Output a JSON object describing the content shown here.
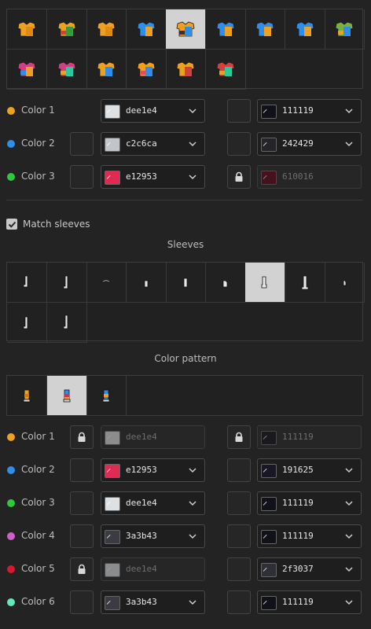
{
  "tops_grid": {
    "items": [
      {
        "icon": "top-icon-1",
        "selected": false
      },
      {
        "icon": "top-icon-2",
        "selected": false
      },
      {
        "icon": "top-icon-3",
        "selected": false
      },
      {
        "icon": "top-icon-4",
        "selected": false
      },
      {
        "icon": "top-icon-5",
        "selected": true
      },
      {
        "icon": "top-icon-6",
        "selected": false
      },
      {
        "icon": "top-icon-7",
        "selected": false
      },
      {
        "icon": "top-icon-8",
        "selected": false
      },
      {
        "icon": "top-icon-9",
        "selected": false
      },
      {
        "icon": "top-icon-10",
        "selected": false
      },
      {
        "icon": "top-icon-11",
        "selected": false
      },
      {
        "icon": "top-icon-12",
        "selected": false
      },
      {
        "icon": "top-icon-13",
        "selected": false
      },
      {
        "icon": "top-icon-14",
        "selected": false
      },
      {
        "icon": "top-icon-15",
        "selected": false
      }
    ]
  },
  "top_colors": [
    {
      "label": "Color 1",
      "dot": "#f0a020",
      "left_lock": false,
      "left_empty": false,
      "primary": {
        "hex": "dee1e4",
        "swatch": "#dee1e4",
        "disabled": false
      },
      "right_lock": false,
      "secondary": {
        "hex": "111119",
        "swatch": "#111119",
        "disabled": false
      }
    },
    {
      "label": "Color 2",
      "dot": "#2f8fe8",
      "left_lock": false,
      "left_empty": true,
      "primary": {
        "hex": "c2c6ca",
        "swatch": "#c2c6ca",
        "disabled": false
      },
      "right_lock": false,
      "secondary": {
        "hex": "242429",
        "swatch": "#242429",
        "disabled": false
      }
    },
    {
      "label": "Color 3",
      "dot": "#2ec840",
      "left_lock": false,
      "left_empty": true,
      "primary": {
        "hex": "e12953",
        "swatch": "#e12953",
        "disabled": false
      },
      "right_lock": true,
      "secondary": {
        "hex": "610016",
        "swatch": "#610016",
        "disabled": true
      }
    }
  ],
  "match_sleeves": {
    "label": "Match sleeves",
    "checked": true
  },
  "sleeves": {
    "title": "Sleeves",
    "items": [
      {
        "icon": "sleeve-icon-1",
        "selected": false
      },
      {
        "icon": "sleeve-icon-2",
        "selected": false
      },
      {
        "icon": "sleeve-icon-3",
        "selected": false
      },
      {
        "icon": "sleeve-icon-4",
        "selected": false
      },
      {
        "icon": "sleeve-icon-5",
        "selected": false
      },
      {
        "icon": "sleeve-icon-6",
        "selected": false
      },
      {
        "icon": "sleeve-icon-7",
        "selected": true
      },
      {
        "icon": "sleeve-icon-8",
        "selected": false
      },
      {
        "icon": "sleeve-icon-9",
        "selected": false
      },
      {
        "icon": "sleeve-icon-10",
        "selected": false
      },
      {
        "icon": "sleeve-icon-11",
        "selected": false
      }
    ]
  },
  "pattern": {
    "title": "Color pattern",
    "items": [
      {
        "icon": "pattern-icon-1",
        "selected": false
      },
      {
        "icon": "pattern-icon-2",
        "selected": true
      },
      {
        "icon": "pattern-icon-3",
        "selected": false
      }
    ]
  },
  "pattern_colors": [
    {
      "label": "Color 1",
      "dot": "#f0a020",
      "left_lock": true,
      "primary": {
        "hex": "dee1e4",
        "swatch": "#dee1e4",
        "disabled": true
      },
      "right_lock": true,
      "secondary": {
        "hex": "111119",
        "swatch": "#111119",
        "disabled": true
      }
    },
    {
      "label": "Color 2",
      "dot": "#2f8fe8",
      "left_lock": false,
      "primary": {
        "hex": "e12953",
        "swatch": "#e12953",
        "disabled": false
      },
      "right_lock": false,
      "secondary": {
        "hex": "191625",
        "swatch": "#191625",
        "disabled": false
      }
    },
    {
      "label": "Color 3",
      "dot": "#2ec840",
      "left_lock": false,
      "primary": {
        "hex": "dee1e4",
        "swatch": "#dee1e4",
        "disabled": false
      },
      "right_lock": false,
      "secondary": {
        "hex": "111119",
        "swatch": "#111119",
        "disabled": false
      }
    },
    {
      "label": "Color 4",
      "dot": "#d060c8",
      "left_lock": false,
      "primary": {
        "hex": "3a3b43",
        "swatch": "#3a3b43",
        "disabled": false
      },
      "right_lock": false,
      "secondary": {
        "hex": "111119",
        "swatch": "#111119",
        "disabled": false
      }
    },
    {
      "label": "Color 5",
      "dot": "#d81830",
      "left_lock": true,
      "primary": {
        "hex": "dee1e4",
        "swatch": "#dee1e4",
        "disabled": true
      },
      "right_lock": false,
      "secondary": {
        "hex": "2f3037",
        "swatch": "#2f3037",
        "disabled": false
      }
    },
    {
      "label": "Color 6",
      "dot": "#60e8b8",
      "left_lock": false,
      "primary": {
        "hex": "3a3b43",
        "swatch": "#3a3b43",
        "disabled": false
      },
      "right_lock": false,
      "secondary": {
        "hex": "111119",
        "swatch": "#111119",
        "disabled": false
      }
    }
  ]
}
